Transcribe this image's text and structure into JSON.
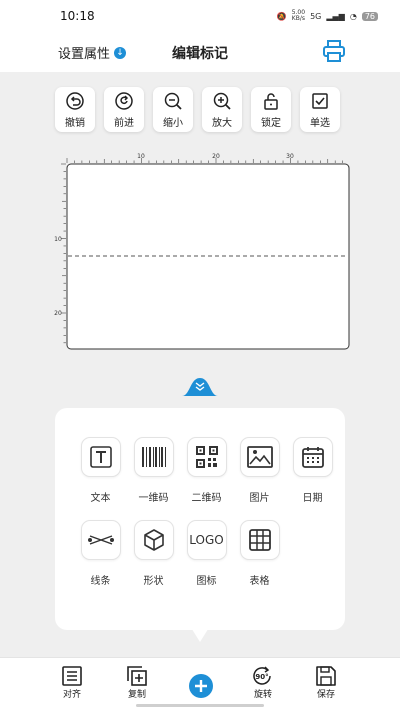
{
  "status_bar": {
    "time": "10:18",
    "speed_value": "5.00",
    "speed_unit": "KB/s",
    "network": "5G",
    "battery": "76"
  },
  "header": {
    "settings_label": "设置属性",
    "title": "编辑标记"
  },
  "toolbar": [
    {
      "label": "撤销",
      "icon": "undo-icon"
    },
    {
      "label": "前进",
      "icon": "redo-icon"
    },
    {
      "label": "缩小",
      "icon": "zoom-out-icon"
    },
    {
      "label": "放大",
      "icon": "zoom-in-icon"
    },
    {
      "label": "锁定",
      "icon": "lock-icon"
    },
    {
      "label": "单选",
      "icon": "checkbox-icon"
    }
  ],
  "ruler": {
    "top_marks": [
      "10",
      "20",
      "30"
    ],
    "left_marks": [
      "10",
      "20"
    ]
  },
  "elements_panel": [
    {
      "label": "文本",
      "icon": "text-icon"
    },
    {
      "label": "一维码",
      "icon": "barcode-icon"
    },
    {
      "label": "二维码",
      "icon": "qrcode-icon"
    },
    {
      "label": "图片",
      "icon": "image-icon"
    },
    {
      "label": "日期",
      "icon": "calendar-icon"
    },
    {
      "label": "线条",
      "icon": "line-icon"
    },
    {
      "label": "形状",
      "icon": "cube-icon"
    },
    {
      "label": "图标",
      "icon": "logo-icon",
      "icon_text": "LOGO"
    },
    {
      "label": "表格",
      "icon": "table-icon"
    }
  ],
  "bottom_bar": {
    "align_label": "对齐",
    "copy_label": "复制",
    "rotate_label": "旋转",
    "rotate_badge": "90°",
    "save_label": "保存"
  },
  "colors": {
    "accent": "#1e8fd6",
    "background": "#efefef"
  }
}
